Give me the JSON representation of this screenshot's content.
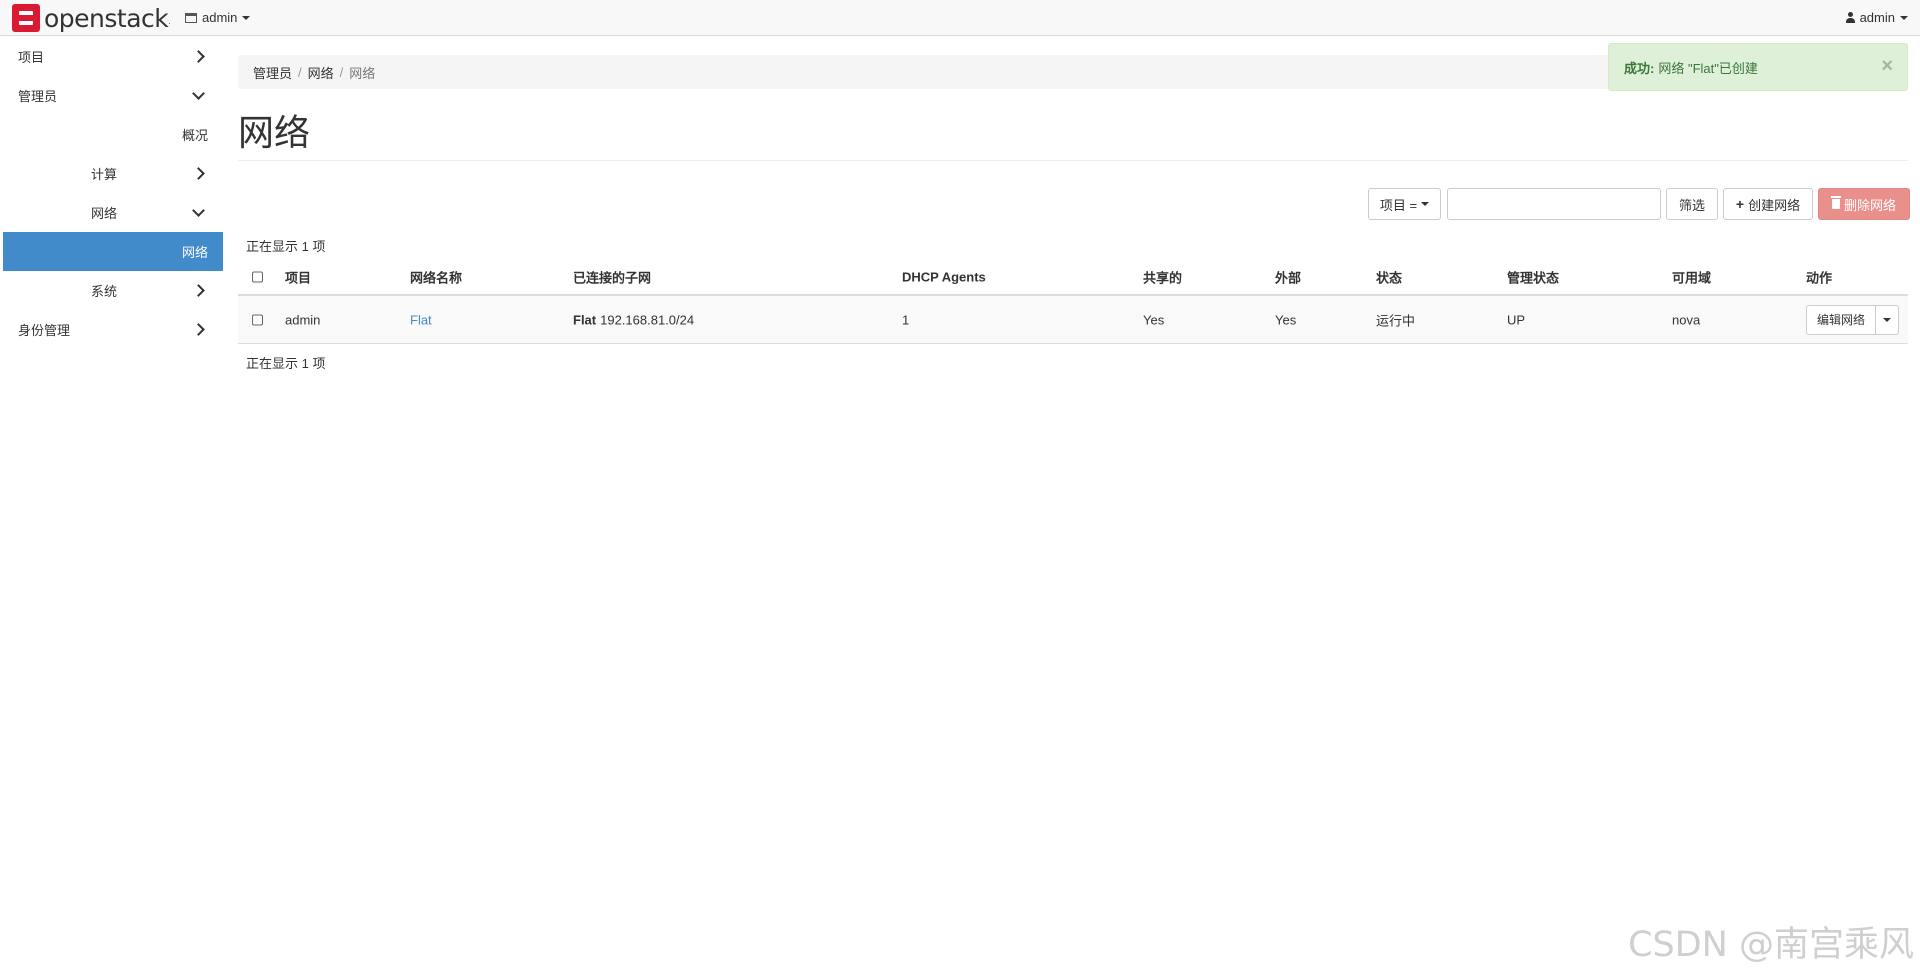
{
  "brand": {
    "logo_text": "openstack",
    "reg_mark": "."
  },
  "header": {
    "project_switcher": "admin",
    "user_menu": "admin"
  },
  "sidebar": {
    "items": [
      {
        "label": "项目",
        "state": "collapsed"
      },
      {
        "label": "管理员",
        "state": "expanded"
      },
      {
        "label": "概况"
      },
      {
        "label": "计算",
        "state": "collapsed"
      },
      {
        "label": "网络",
        "state": "expanded"
      },
      {
        "label": "网络",
        "active": true
      },
      {
        "label": "系统",
        "state": "collapsed"
      },
      {
        "label": "身份管理",
        "state": "collapsed"
      }
    ]
  },
  "breadcrumb": [
    "管理员",
    "网络",
    "网络"
  ],
  "breadcrumb_sep": "/",
  "page_title": "网络",
  "alert": {
    "prefix": "成功:",
    "message": "网络 \"Flat\"已创建",
    "close": "×"
  },
  "toolbar": {
    "filter_field": "项目 =",
    "filter_value": "",
    "filter_button": "筛选",
    "create_button": "创建网络",
    "delete_button": "删除网络"
  },
  "count_text": "正在显示 1 项",
  "table": {
    "columns": [
      "项目",
      "网络名称",
      "已连接的子网",
      "DHCP Agents",
      "共享的",
      "外部",
      "状态",
      "管理状态",
      "可用域",
      "动作"
    ],
    "rows": [
      {
        "project": "admin",
        "name": "Flat",
        "subnet_name": "Flat",
        "subnet_cidr": "192.168.81.0/24",
        "dhcp_agents": "1",
        "shared": "Yes",
        "external": "Yes",
        "status": "运行中",
        "admin_state": "UP",
        "az": "nova",
        "action": "编辑网络"
      }
    ]
  },
  "watermark": "CSDN @南宫乘风",
  "colors": {
    "accent": "#428bca",
    "brand": "#da1a32",
    "danger": "#e9908d",
    "success_bg": "#dff0d8",
    "success_text": "#3c763d"
  }
}
